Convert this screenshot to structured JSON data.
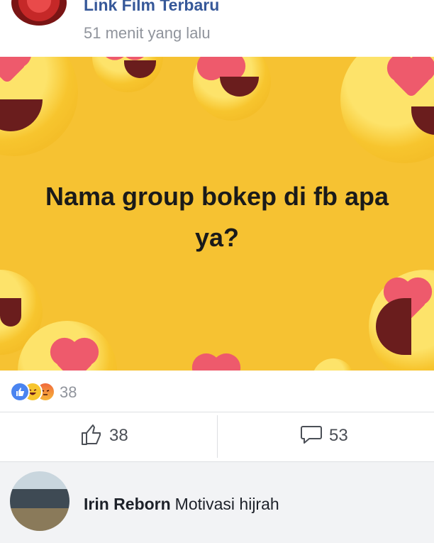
{
  "post": {
    "page_name": "Link Film Terbaru",
    "timestamp": "51 menit yang lalu",
    "image_text_line1": "Nama group bokep di fb apa",
    "image_text_line2": "ya?"
  },
  "reactions": {
    "count": "38",
    "types": [
      "like-icon",
      "haha-icon",
      "angry-icon"
    ]
  },
  "actions": {
    "like_count": "38",
    "comment_count": "53"
  },
  "comment": {
    "author": "Irin Reborn",
    "text": "Motivasi hijrah"
  },
  "colors": {
    "link": "#365899",
    "muted": "#90949c",
    "image_bg": "#f6c232",
    "like_blue": "#4a84f0"
  }
}
